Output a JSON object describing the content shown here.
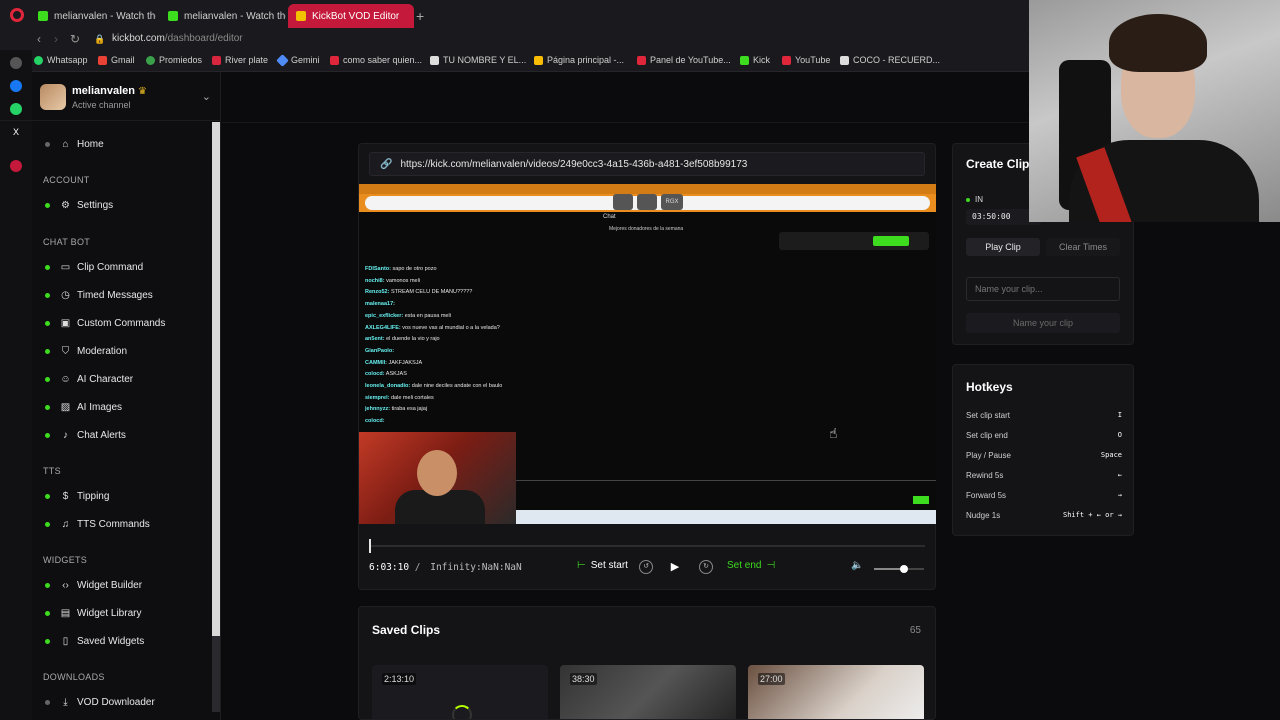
{
  "browser": {
    "tabs": [
      {
        "label": "melianvalen - Watch the V",
        "active": false
      },
      {
        "label": "melianvalen - Watch the V",
        "active": false
      },
      {
        "label": "KickBot VOD Editor",
        "active": true
      }
    ],
    "url_host": "kickbot.com",
    "url_path": "/dashboard/editor",
    "bookmarks": [
      {
        "label": "Whatsapp",
        "color": "#25d366"
      },
      {
        "label": "Gmail",
        "color": "#ea4335"
      },
      {
        "label": "Promiedos",
        "color": "#3aa14a"
      },
      {
        "label": "River plate",
        "color": "#d7263d"
      },
      {
        "label": "Gemini",
        "color": "#4f8bf5"
      },
      {
        "label": "como saber quien...",
        "color": "#e0263a"
      },
      {
        "label": "TU NOMBRE Y EL...",
        "color": "#dddddd"
      },
      {
        "label": "Página principal -...",
        "color": "#fbbc04"
      },
      {
        "label": "Panel de YouTube...",
        "color": "#e0263a"
      },
      {
        "label": "Kick",
        "color": "#3ddc1e"
      },
      {
        "label": "YouTube",
        "color": "#e0263a"
      },
      {
        "label": "COCO - RECUERD...",
        "color": "#dddddd"
      }
    ]
  },
  "sidebar": {
    "user_name": "melianvalen",
    "user_status": "Active channel",
    "home": "Home",
    "sections": {
      "account": "ACCOUNT",
      "chatbot": "CHAT BOT",
      "tts": "TTS",
      "widgets": "WIDGETS",
      "downloads": "DOWNLOADS"
    },
    "items": {
      "settings": "Settings",
      "clip_command": "Clip Command",
      "timed_messages": "Timed Messages",
      "custom_commands": "Custom Commands",
      "moderation": "Moderation",
      "ai_character": "AI Character",
      "ai_images": "AI Images",
      "chat_alerts": "Chat Alerts",
      "tipping": "Tipping",
      "tts_commands": "TTS Commands",
      "widget_builder": "Widget Builder",
      "widget_library": "Widget Library",
      "saved_widgets": "Saved Widgets",
      "vod_downloader": "VOD Downloader"
    }
  },
  "player": {
    "vod_url": "https://kick.com/melianvalen/videos/249e0cc3-4a15-436b-a481-3ef508b99173",
    "current_time": "6:03:10",
    "total_time": "Infinity:NaN:NaN",
    "set_start": "Set start",
    "set_end": "Set end",
    "progress_fraction": 0.0,
    "volume_fraction": 0.6,
    "video_chat": {
      "header": "Chat",
      "pill_label": "RGX",
      "donors": "Mejores donadores de la semana",
      "lines": [
        {
          "user": "FDISanto:",
          "text": "sapo de otro pozo"
        },
        {
          "user": "nochi8:",
          "text": "vamonos meli"
        },
        {
          "user": "Renzo52:",
          "text": "STREAM CELU DE MANU?????"
        },
        {
          "user": "malenaa17:",
          "text": ""
        },
        {
          "user": "epic_exflicker:",
          "text": "esta en pausa meli"
        },
        {
          "user": "AXLEG4LIFE:",
          "text": "vos nueve vas al mundial o a la velada?"
        },
        {
          "user": "an5ent:",
          "text": "el duende la vio y rajo"
        },
        {
          "user": "GianPaolo:",
          "text": ""
        },
        {
          "user": "CAMMII:",
          "text": "JAKFJAKSJA"
        },
        {
          "user": "colocd:",
          "text": "ASKJAS"
        },
        {
          "user": "leonela_donadio:",
          "text": "dale nine deciles andate con el baulo"
        },
        {
          "user": "siemprel:",
          "text": "dale meli cortales"
        },
        {
          "user": "jehnnyzz:",
          "text": "tiraba esa jajaj"
        },
        {
          "user": "colocd:",
          "text": ""
        }
      ]
    }
  },
  "saved_clips": {
    "title": "Saved Clips",
    "count": "65",
    "clips": [
      {
        "duration": "2:13:10"
      },
      {
        "duration": "38:30"
      },
      {
        "duration": "27:00"
      }
    ]
  },
  "create_clip": {
    "title": "Create Clip",
    "in_label": "IN",
    "in_time": "03:50:00",
    "play_clip": "Play Clip",
    "clear_times": "Clear Times",
    "name_placeholder": "Name your clip...",
    "name_button": "Name your clip"
  },
  "hotkeys": {
    "title": "Hotkeys",
    "rows": [
      {
        "label": "Set clip start",
        "key": "I"
      },
      {
        "label": "Set clip end",
        "key": "O"
      },
      {
        "label": "Play / Pause",
        "key": "Space"
      },
      {
        "label": "Rewind 5s",
        "key": "←"
      },
      {
        "label": "Forward 5s",
        "key": "→"
      },
      {
        "label": "Nudge 1s",
        "key": "Shift + ← or →"
      }
    ]
  }
}
